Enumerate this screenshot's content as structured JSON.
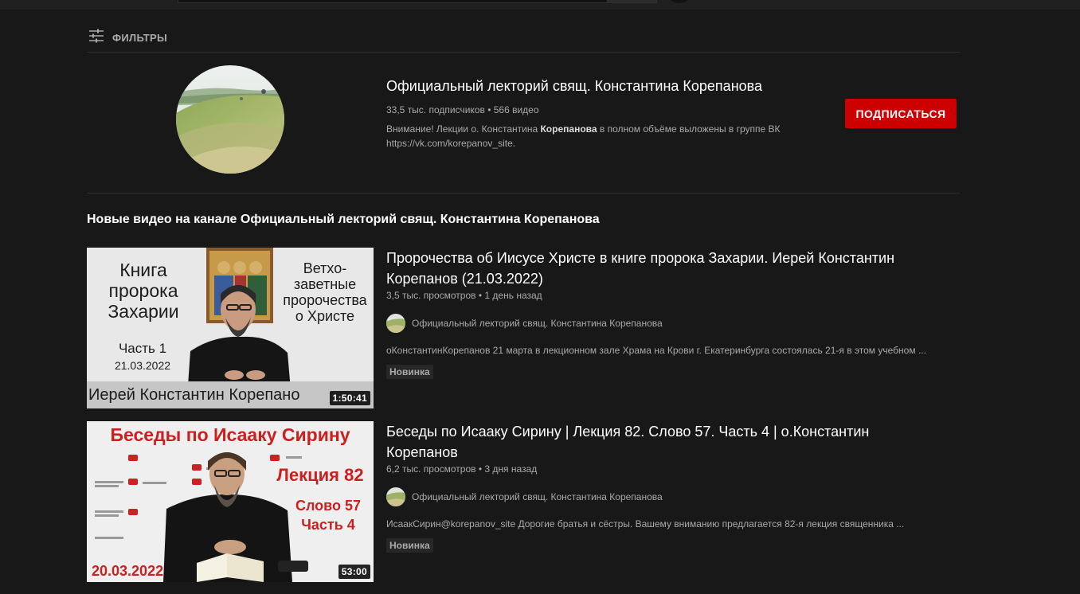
{
  "filters": {
    "label": "ФИЛЬТРЫ",
    "icon": "sliders-icon"
  },
  "channel": {
    "title": "Официальный лекторий свящ. Константина Корепанова",
    "subscribers": "33,5 тыс. подписчиков",
    "video_count": "566 видео",
    "description_pre": "Внимание! Лекции о. Константина ",
    "description_bold": "Корепанова",
    "description_post": " в полном объёме выложены в группе ВК https://vk.com/korepanov_site.",
    "subscribe_label": "ПОДПИСАТЬСЯ"
  },
  "section_title": "Новые видео на канале Официальный лекторий свящ. Константина Корепанова",
  "videos": [
    {
      "title": "Пророчества об Иисусе Христе в книге пророка Захарии. Иерей Константин Корепанов (21.03.2022)",
      "views": "3,5 тыс. просмотров",
      "age": "1 день назад",
      "channel": "Официальный лекторий свящ. Константина Корепанова",
      "description": "оКонстантинКорепанов 21 марта в лекционном зале Храма на Крови г. Екатеринбурга состоялась 21-я в этом учебном ...",
      "badge": "Новинка",
      "duration": "1:50:41",
      "thumb": {
        "left_title": "Книга пророка Захарии",
        "left_part": "Часть 1",
        "left_date": "21.03.2022",
        "right_title": "Ветхо-заветные пророчества о Христе",
        "banner": "Иерей Константин Корепано"
      }
    },
    {
      "title": "Беседы по Исааку Сирину | Лекция 82. Слово 57. Часть 4 | о.Константин Корепанов",
      "views": "6,2 тыс. просмотров",
      "age": "3 дня назад",
      "channel": "Официальный лекторий свящ. Константина Корепанова",
      "description": "ИсаакСирин@korepanov_site Дорогие братья и сёстры. Вашему вниманию предлагается 82-я лекция священника ...",
      "badge": "Новинка",
      "duration": "53:00",
      "thumb": {
        "header": "Беседы по Исааку Сирину",
        "lecture": "Лекция 82",
        "word": "Слово 57",
        "part": "Часть 4",
        "date": "20.03.2022"
      }
    }
  ],
  "colors": {
    "background": "#181818",
    "subscribe": "#cc0000",
    "thumb_red": "#c0282a"
  }
}
